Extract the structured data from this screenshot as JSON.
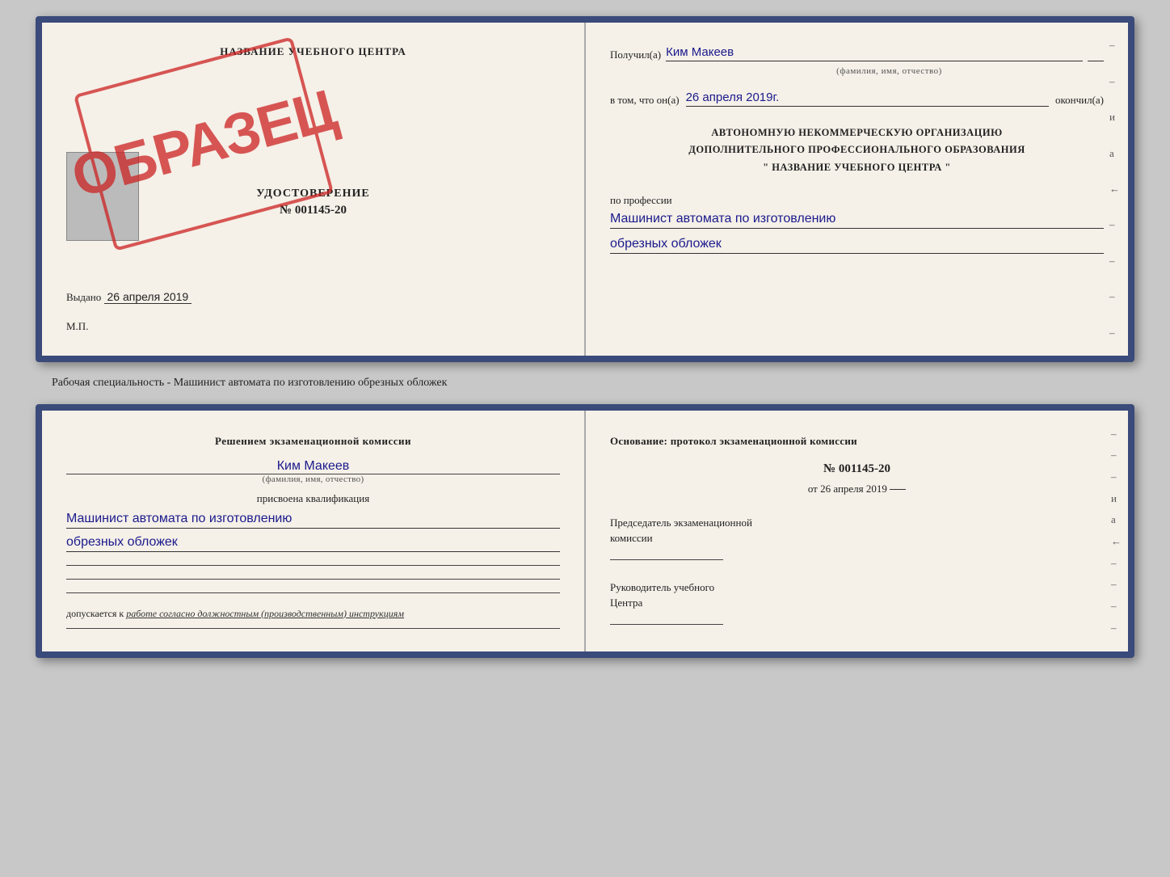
{
  "top_doc": {
    "left": {
      "title": "НАЗВАНИЕ УЧЕБНОГО ЦЕНТРА",
      "cert_type": "УДОСТОВЕРЕНИЕ",
      "cert_number": "№ 001145-20",
      "issued_label": "Выдано",
      "issued_date": "26 апреля 2019",
      "mp_label": "М.П.",
      "stamp_text": "ОБРАЗЕЦ"
    },
    "right": {
      "received_label": "Получил(а)",
      "name_hw": "Ким Макеев",
      "name_sublabel": "(фамилия, имя, отчество)",
      "date_label": "в том, что он(а)",
      "date_hw": "26 апреля 2019г.",
      "completed_label": "окончил(а)",
      "org_line1": "АВТОНОМНУЮ НЕКОММЕРЧЕСКУЮ ОРГАНИЗАЦИЮ",
      "org_line2": "ДОПОЛНИТЕЛЬНОГО ПРОФЕССИОНАЛЬНОГО ОБРАЗОВАНИЯ",
      "org_line3": "\"   НАЗВАНИЕ УЧЕБНОГО ЦЕНТРА   \"",
      "profession_label": "по профессии",
      "profession_hw1": "Машинист автомата по изготовлению",
      "profession_hw2": "обрезных обложек"
    }
  },
  "caption": "Рабочая специальность - Машинист автомата по изготовлению обрезных обложек",
  "bottom_doc": {
    "left": {
      "header1": "Решением экзаменационной комиссии",
      "person_hw": "Ким Макеев",
      "person_sublabel": "(фамилия, имя, отчество)",
      "qual_label": "присвоена квалификация",
      "qual_hw1": "Машинист автомата по изготовлению",
      "qual_hw2": "обрезных обложек",
      "допускается_label": "допускается к",
      "допускается_hw": "работе согласно должностным (производственным) инструкциям"
    },
    "right": {
      "osnov_label": "Основание: протокол экзаменационной комиссии",
      "protocol_number": "№  001145-20",
      "protocol_date_prefix": "от",
      "protocol_date": "26 апреля 2019",
      "chairman_label1": "Председатель экзаменационной",
      "chairman_label2": "комиссии",
      "director_label1": "Руководитель учебного",
      "director_label2": "Центра"
    }
  },
  "dashes": [
    "-",
    "-",
    "-",
    "и",
    "а",
    "←",
    "-",
    "-",
    "-",
    "-"
  ]
}
